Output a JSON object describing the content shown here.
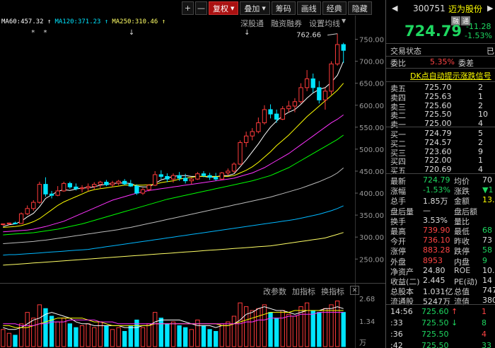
{
  "toolbar": {
    "items": [
      "+",
      "—",
      "复权",
      "叠加",
      "筹码",
      "画线",
      "经典",
      "隐藏"
    ]
  },
  "ma_legend": [
    {
      "label": "MA60:457.32 ↑",
      "color": "#ffffff"
    },
    {
      "label": "MA120:371.23 ↑",
      "color": "#00e5ff"
    },
    {
      "label": "MA250:310.46 ↑",
      "color": "#ffff66"
    }
  ],
  "sub_links": [
    "深股通",
    "融资融券",
    "设置均线"
  ],
  "price_axis": {
    "labels": [
      "750.00",
      "700.00",
      "650.00",
      "600.00",
      "550.00",
      "500.00",
      "450.00",
      "400.00",
      "350.00",
      "300.00",
      "250.00"
    ],
    "high_note": "762.66"
  },
  "volume_axis": {
    "labels": [
      "2.68",
      "1.34",
      "万"
    ]
  },
  "volume_tools": [
    "改参数",
    "加指标",
    "换指标",
    "✕"
  ],
  "chart_data": {
    "type": "candlestick",
    "ylim": [
      215,
      775
    ],
    "candles": [
      [
        329,
        331,
        326,
        330
      ],
      [
        330,
        333,
        328,
        332
      ],
      [
        332,
        335,
        329,
        331
      ],
      [
        331,
        356,
        330,
        353
      ],
      [
        353,
        372,
        350,
        365
      ],
      [
        365,
        384,
        360,
        379
      ],
      [
        379,
        426,
        376,
        420
      ],
      [
        420,
        436,
        392,
        398
      ],
      [
        398,
        405,
        388,
        395
      ],
      [
        395,
        416,
        393,
        405
      ],
      [
        405,
        426,
        403,
        422
      ],
      [
        422,
        426,
        410,
        414
      ],
      [
        414,
        422,
        406,
        410
      ],
      [
        410,
        418,
        402,
        412
      ],
      [
        412,
        422,
        404,
        415
      ],
      [
        415,
        425,
        408,
        420
      ],
      [
        420,
        428,
        410,
        425
      ],
      [
        425,
        430,
        416,
        419
      ],
      [
        419,
        428,
        414,
        423
      ],
      [
        423,
        430,
        418,
        427
      ],
      [
        427,
        432,
        418,
        421
      ],
      [
        421,
        430,
        414,
        416
      ],
      [
        416,
        420,
        396,
        400
      ],
      [
        400,
        412,
        396,
        408
      ],
      [
        408,
        420,
        404,
        418
      ],
      [
        418,
        450,
        416,
        442
      ],
      [
        442,
        452,
        432,
        438
      ],
      [
        438,
        445,
        425,
        432
      ],
      [
        432,
        445,
        424,
        440
      ],
      [
        440,
        448,
        428,
        434
      ],
      [
        434,
        444,
        422,
        428
      ],
      [
        428,
        436,
        420,
        432
      ],
      [
        432,
        448,
        430,
        444
      ],
      [
        444,
        450,
        436,
        440
      ],
      [
        440,
        446,
        430,
        436
      ],
      [
        436,
        446,
        428,
        432
      ],
      [
        432,
        448,
        430,
        446
      ],
      [
        446,
        456,
        440,
        450
      ],
      [
        450,
        470,
        446,
        466
      ],
      [
        466,
        520,
        464,
        515
      ],
      [
        515,
        540,
        505,
        530
      ],
      [
        530,
        548,
        520,
        540
      ],
      [
        540,
        572,
        536,
        560
      ],
      [
        560,
        600,
        556,
        590
      ],
      [
        590,
        602,
        570,
        580
      ],
      [
        580,
        590,
        560,
        568
      ],
      [
        568,
        598,
        566,
        592
      ],
      [
        592,
        610,
        584,
        598
      ],
      [
        598,
        616,
        584,
        608
      ],
      [
        608,
        650,
        604,
        640
      ],
      [
        640,
        680,
        632,
        660
      ],
      [
        660,
        672,
        628,
        640
      ],
      [
        640,
        655,
        604,
        612
      ],
      [
        612,
        640,
        590,
        632
      ],
      [
        632,
        700,
        624,
        694
      ],
      [
        694,
        762.66,
        690,
        738
      ],
      [
        738,
        742,
        696,
        724.79
      ]
    ],
    "ma_lines": [
      {
        "name": "MA5",
        "color": "#ffffff",
        "values": [
          324,
          328,
          330,
          336,
          346,
          354,
          369,
          388,
          396,
          404,
          408,
          406,
          409,
          412,
          412,
          414,
          418,
          420,
          422,
          423,
          423,
          422,
          416,
          414,
          414,
          422,
          430,
          434,
          438,
          440,
          440,
          438,
          438,
          438,
          436,
          437,
          440,
          440,
          444,
          460,
          476,
          494,
          512,
          532,
          550,
          564,
          576,
          584,
          590,
          602,
          616,
          628,
          636,
          640,
          652,
          668,
          700
        ]
      },
      {
        "name": "MA10",
        "color": "#ffff00",
        "values": [
          322,
          323,
          324,
          326,
          330,
          335,
          342,
          352,
          362,
          372,
          380,
          386,
          392,
          398,
          404,
          408,
          410,
          412,
          414,
          416,
          418,
          418,
          418,
          418,
          419,
          420,
          424,
          426,
          428,
          432,
          434,
          436,
          438,
          438,
          438,
          438,
          438,
          438,
          440,
          446,
          452,
          460,
          470,
          482,
          494,
          508,
          520,
          532,
          546,
          560,
          574,
          586,
          598,
          610,
          622,
          634,
          650
        ]
      },
      {
        "name": "MA20",
        "color": "#ff33ff",
        "values": [
          312,
          313,
          314,
          315,
          316,
          318,
          321,
          324,
          328,
          332,
          336,
          342,
          348,
          354,
          360,
          366,
          372,
          378,
          384,
          388,
          392,
          396,
          400,
          403,
          406,
          408,
          410,
          412,
          414,
          416,
          418,
          420,
          422,
          424,
          426,
          428,
          430,
          432,
          434,
          438,
          442,
          446,
          452,
          458,
          466,
          474,
          482,
          490,
          500,
          510,
          520,
          530,
          540,
          550,
          560,
          568,
          578
        ]
      },
      {
        "name": "MA30",
        "color": "#00ff00",
        "values": [
          305,
          306,
          307,
          308,
          309,
          310,
          312,
          314,
          316,
          318,
          321,
          324,
          327,
          330,
          334,
          338,
          342,
          346,
          350,
          354,
          358,
          362,
          366,
          370,
          374,
          378,
          382,
          386,
          389,
          392,
          395,
          398,
          401,
          404,
          407,
          410,
          413,
          416,
          419,
          422,
          425,
          428,
          432,
          436,
          440,
          446,
          452,
          458,
          466,
          474,
          482,
          490,
          498,
          506,
          514,
          522,
          532
        ]
      },
      {
        "name": "MA60",
        "color": "#bbbbbb",
        "values": [
          285,
          286,
          287,
          288,
          289,
          290,
          292,
          293,
          295,
          297,
          299,
          301,
          303,
          305,
          307,
          309,
          311,
          313,
          315,
          317,
          320,
          322,
          325,
          328,
          331,
          334,
          337,
          340,
          343,
          346,
          349,
          352,
          355,
          358,
          361,
          364,
          367,
          370,
          373,
          376,
          379,
          382,
          385,
          388,
          391,
          395,
          399,
          403,
          407,
          411,
          416,
          421,
          426,
          432,
          438,
          446,
          457.32
        ]
      },
      {
        "name": "MA120",
        "color": "#00b7ff",
        "values": [
          259,
          260,
          260,
          261,
          262,
          263,
          264,
          265,
          266,
          267,
          268,
          269,
          270,
          271,
          272,
          274,
          276,
          278,
          280,
          282,
          284,
          286,
          288,
          290,
          292,
          294,
          296,
          298,
          300,
          302,
          304,
          306,
          308,
          310,
          312,
          314,
          316,
          318,
          320,
          322,
          324,
          326,
          328,
          330,
          332,
          334,
          336,
          338,
          340,
          343,
          346,
          349,
          352,
          356,
          360,
          365,
          371.23
        ]
      },
      {
        "name": "MA250",
        "color": "#ffff66",
        "values": [
          236,
          237,
          238,
          239,
          240,
          241,
          242,
          243,
          244,
          245,
          246,
          247,
          248,
          249,
          250,
          251,
          252,
          253,
          254,
          255,
          256,
          257,
          258,
          259,
          260,
          261,
          262,
          263,
          264,
          265,
          266,
          267,
          268,
          269,
          270,
          271,
          272,
          273,
          274,
          275,
          276,
          277,
          278,
          279,
          280,
          282,
          284,
          286,
          288,
          290,
          292,
          294,
          296,
          298,
          302,
          306,
          310.46
        ]
      }
    ],
    "volume": [
      0.9,
      0.7,
      0.6,
      1.2,
      1.8,
      1.5,
      2.2,
      2.0,
      1.6,
      1.3,
      1.5,
      1.2,
      1.0,
      1.1,
      1.2,
      1.0,
      1.3,
      1.1,
      0.9,
      1.0,
      0.8,
      1.1,
      1.4,
      1.0,
      1.2,
      1.8,
      1.5,
      1.2,
      1.3,
      1.1,
      1.0,
      0.9,
      1.4,
      1.1,
      0.9,
      0.8,
      1.2,
      1.3,
      1.6,
      2.3,
      2.1,
      1.9,
      2.0,
      2.2,
      1.8,
      1.5,
      1.9,
      1.7,
      1.6,
      2.1,
      2.3,
      1.9,
      1.8,
      2.0,
      2.2,
      2.4,
      1.8
    ],
    "volume_ylim": [
      0,
      2.68
    ],
    "vol_ma_lines": [
      {
        "name": "VOL-MA5",
        "color": "#ffffff",
        "values": [
          1.0,
          0.9,
          0.9,
          1.0,
          1.2,
          1.4,
          1.5,
          1.7,
          1.8,
          1.7,
          1.6,
          1.5,
          1.3,
          1.2,
          1.2,
          1.1,
          1.1,
          1.1,
          1.1,
          1.1,
          1.0,
          1.0,
          1.0,
          1.1,
          1.1,
          1.3,
          1.4,
          1.4,
          1.4,
          1.4,
          1.3,
          1.2,
          1.1,
          1.1,
          1.1,
          1.0,
          1.1,
          1.1,
          1.2,
          1.4,
          1.7,
          1.8,
          2.0,
          2.1,
          2.0,
          1.9,
          1.9,
          1.8,
          1.7,
          1.8,
          1.9,
          1.9,
          1.9,
          2.0,
          2.0,
          2.1,
          2.0
        ]
      },
      {
        "name": "VOL-MA10",
        "color": "#ffff00",
        "values": [
          1.1,
          1.1,
          1.0,
          1.0,
          1.0,
          1.1,
          1.2,
          1.3,
          1.4,
          1.5,
          1.5,
          1.5,
          1.5,
          1.5,
          1.4,
          1.3,
          1.3,
          1.2,
          1.1,
          1.1,
          1.1,
          1.1,
          1.1,
          1.1,
          1.1,
          1.2,
          1.2,
          1.2,
          1.2,
          1.2,
          1.2,
          1.2,
          1.2,
          1.2,
          1.2,
          1.2,
          1.1,
          1.1,
          1.2,
          1.3,
          1.4,
          1.5,
          1.6,
          1.7,
          1.8,
          1.8,
          1.8,
          1.8,
          1.9,
          1.9,
          1.9,
          1.9,
          1.9,
          1.9,
          1.9,
          1.9,
          1.9
        ]
      },
      {
        "name": "VOL-MA20",
        "color": "#ff33ff",
        "values": [
          1.2,
          1.2,
          1.2,
          1.1,
          1.1,
          1.1,
          1.2,
          1.2,
          1.3,
          1.3,
          1.3,
          1.4,
          1.4,
          1.4,
          1.4,
          1.4,
          1.3,
          1.3,
          1.3,
          1.2,
          1.2,
          1.2,
          1.2,
          1.2,
          1.2,
          1.2,
          1.2,
          1.2,
          1.2,
          1.2,
          1.2,
          1.2,
          1.2,
          1.2,
          1.2,
          1.2,
          1.2,
          1.2,
          1.2,
          1.2,
          1.3,
          1.3,
          1.4,
          1.4,
          1.5,
          1.5,
          1.5,
          1.6,
          1.6,
          1.7,
          1.7,
          1.7,
          1.8,
          1.8,
          1.8,
          1.8,
          1.8
        ]
      }
    ]
  },
  "panel": {
    "code": "300751",
    "name": "迈为股份",
    "badges": [
      "融",
      "通"
    ],
    "price": "724.79",
    "change": "-11.28",
    "change_pct": "-1.53%",
    "status_label": "交易状态",
    "status_value": "已",
    "weibi_label": "委比",
    "weibi_value": "5.35%",
    "weicha_label": "委差",
    "signal_link": "DK点自动提示涨跌信号",
    "asks": [
      {
        "label": "卖五",
        "price": "725.70",
        "vol": "2"
      },
      {
        "label": "卖四",
        "price": "725.63",
        "vol": "1"
      },
      {
        "label": "卖三",
        "price": "725.60",
        "vol": "2"
      },
      {
        "label": "卖二",
        "price": "725.50",
        "vol": "10"
      },
      {
        "label": "卖一",
        "price": "725.00",
        "vol": "4"
      }
    ],
    "bids": [
      {
        "label": "买一",
        "price": "724.79",
        "vol": "5"
      },
      {
        "label": "买二",
        "price": "724.57",
        "vol": "2"
      },
      {
        "label": "买三",
        "price": "723.60",
        "vol": "9"
      },
      {
        "label": "买四",
        "price": "722.00",
        "vol": "1"
      },
      {
        "label": "买五",
        "price": "720.69",
        "vol": "4"
      }
    ],
    "stats": [
      {
        "l1": "最新",
        "v1": "724.79",
        "c1": "g",
        "l2": "均价",
        "v2": "70",
        "c2": "w"
      },
      {
        "l1": "涨幅",
        "v1": "-1.53%",
        "c1": "g",
        "l2": "涨跌",
        "v2": "▼1",
        "c2": "g"
      },
      {
        "l1": "总手",
        "v1": "1.85万",
        "c1": "w",
        "l2": "金额",
        "v2": "13.0",
        "c2": "y"
      },
      {
        "l1": "盘后量",
        "v1": "—",
        "c1": "w",
        "l2": "盘后额",
        "v2": "",
        "c2": "w"
      },
      {
        "l1": "换手",
        "v1": "3.53%",
        "c1": "w",
        "l2": "量比",
        "v2": "",
        "c2": "w"
      },
      {
        "l1": "最高",
        "v1": "739.90",
        "c1": "r",
        "l2": "最低",
        "v2": "68",
        "c2": "g"
      },
      {
        "l1": "今开",
        "v1": "736.10",
        "c1": "r",
        "l2": "昨收",
        "v2": "73",
        "c2": "w"
      },
      {
        "l1": "涨停",
        "v1": "883.28",
        "c1": "r",
        "l2": "跌停",
        "v2": "58",
        "c2": "g"
      },
      {
        "l1": "外盘",
        "v1": "8953",
        "c1": "r",
        "l2": "内盘",
        "v2": "9",
        "c2": "g"
      },
      {
        "l1": "净资产",
        "v1": "24.80",
        "c1": "w",
        "l2": "ROE",
        "v2": "10.",
        "c2": "w"
      },
      {
        "l1": "收益(二)",
        "v1": "2.445",
        "c1": "w",
        "l2": "PE(动)",
        "v2": "14",
        "c2": "w"
      },
      {
        "l1": "总股本",
        "v1": "1.031亿",
        "c1": "w",
        "l2": "总值",
        "v2": "747",
        "c2": "w"
      },
      {
        "l1": "流通股",
        "v1": "5247万",
        "c1": "w",
        "l2": "流值",
        "v2": "380",
        "c2": "w"
      }
    ],
    "ticks": [
      {
        "time": "14:56",
        "price": "725.60",
        "arrow": "↑",
        "arrow_c": "r",
        "vol": "1",
        "vol_c": "r"
      },
      {
        "time": ":33",
        "price": "725.50",
        "arrow": "↓",
        "arrow_c": "g",
        "vol": "8",
        "vol_c": "g"
      },
      {
        "time": ":36",
        "price": "725.50",
        "arrow": "",
        "arrow_c": "w",
        "vol": "4",
        "vol_c": "r"
      },
      {
        "time": ":42",
        "price": "725.50",
        "arrow": "",
        "arrow_c": "w",
        "vol": "33",
        "vol_c": "g"
      }
    ]
  }
}
